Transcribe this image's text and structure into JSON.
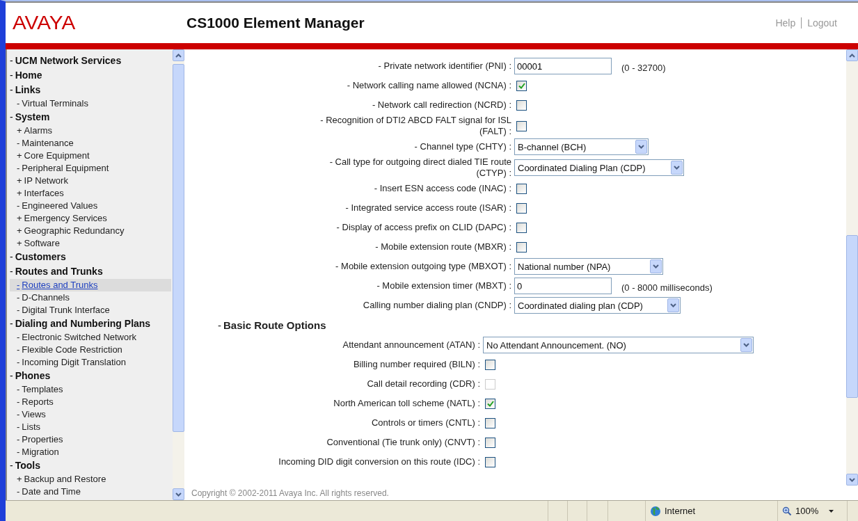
{
  "header": {
    "logo": "AVAYA",
    "title": "CS1000 Element Manager",
    "links": [
      "Help",
      "Logout"
    ]
  },
  "sidebar": {
    "items": [
      {
        "marker": "-",
        "label": "UCM Network Services",
        "selected": false
      },
      {
        "marker": "-",
        "label": "Home",
        "selected": false
      },
      {
        "marker": "-",
        "label": "Links",
        "selected": false,
        "children": [
          {
            "marker": "-",
            "label": "Virtual Terminals",
            "selected": false
          }
        ]
      },
      {
        "marker": "-",
        "label": "System",
        "selected": false,
        "children": [
          {
            "marker": "+",
            "label": "Alarms",
            "selected": false
          },
          {
            "marker": "-",
            "label": "Maintenance",
            "selected": false
          },
          {
            "marker": "+",
            "label": "Core Equipment",
            "selected": false
          },
          {
            "marker": "-",
            "label": "Peripheral Equipment",
            "selected": false
          },
          {
            "marker": "+",
            "label": "IP Network",
            "selected": false
          },
          {
            "marker": "+",
            "label": "Interfaces",
            "selected": false
          },
          {
            "marker": "-",
            "label": "Engineered Values",
            "selected": false
          },
          {
            "marker": "+",
            "label": "Emergency Services",
            "selected": false
          },
          {
            "marker": "+",
            "label": "Geographic Redundancy",
            "selected": false
          },
          {
            "marker": "+",
            "label": "Software",
            "selected": false
          }
        ]
      },
      {
        "marker": "-",
        "label": "Customers",
        "selected": false
      },
      {
        "marker": "-",
        "label": "Routes and Trunks",
        "selected": false,
        "children": [
          {
            "marker": "-",
            "label": "Routes and Trunks",
            "selected": true
          },
          {
            "marker": "-",
            "label": "D-Channels",
            "selected": false
          },
          {
            "marker": "-",
            "label": "Digital Trunk Interface",
            "selected": false
          }
        ]
      },
      {
        "marker": "-",
        "label": "Dialing and Numbering Plans",
        "selected": false,
        "children": [
          {
            "marker": "-",
            "label": "Electronic Switched Network",
            "selected": false
          },
          {
            "marker": "-",
            "label": "Flexible Code Restriction",
            "selected": false
          },
          {
            "marker": "-",
            "label": "Incoming Digit Translation",
            "selected": false
          }
        ]
      },
      {
        "marker": "-",
        "label": "Phones",
        "selected": false,
        "children": [
          {
            "marker": "-",
            "label": "Templates",
            "selected": false
          },
          {
            "marker": "-",
            "label": "Reports",
            "selected": false
          },
          {
            "marker": "-",
            "label": "Views",
            "selected": false
          },
          {
            "marker": "-",
            "label": "Lists",
            "selected": false
          },
          {
            "marker": "-",
            "label": "Properties",
            "selected": false
          },
          {
            "marker": "-",
            "label": "Migration",
            "selected": false
          }
        ]
      },
      {
        "marker": "-",
        "label": "Tools",
        "selected": false,
        "children": [
          {
            "marker": "+",
            "label": "Backup and Restore",
            "selected": false
          },
          {
            "marker": "-",
            "label": "Date and Time",
            "selected": false
          }
        ]
      }
    ]
  },
  "form": {
    "sections": [
      {
        "rows": [
          {
            "kind": "text",
            "label": "- Private network identifier (PNI) :",
            "value": "00001",
            "note": "(0 - 32700)"
          },
          {
            "kind": "checkbox",
            "label": "- Network calling name allowed (NCNA) :",
            "checked": true,
            "disabled": false
          },
          {
            "kind": "checkbox",
            "label": "- Network call redirection (NCRD) :",
            "checked": false,
            "disabled": false
          },
          {
            "kind": "checkbox",
            "label": "- Recognition of DTI2 ABCD FALT signal for ISL (FALT) :",
            "checked": false,
            "disabled": false
          },
          {
            "kind": "select",
            "label": "- Channel type  (CHTY) :",
            "value": "B-channel (BCH)"
          },
          {
            "kind": "select",
            "label": "- Call type for outgoing direct dialed TIE route (CTYP) :",
            "value": "Coordinated Dialing Plan (CDP)"
          },
          {
            "kind": "checkbox",
            "label": "- Insert ESN access code  (INAC) :",
            "checked": false,
            "disabled": false
          },
          {
            "kind": "checkbox",
            "label": "- Integrated service access route (ISAR) :",
            "checked": false,
            "disabled": false
          },
          {
            "kind": "checkbox",
            "label": "- Display of access prefix on CLID (DAPC) :",
            "checked": false,
            "disabled": false
          },
          {
            "kind": "checkbox",
            "label": "- Mobile extension route (MBXR) :",
            "checked": false,
            "disabled": false
          },
          {
            "kind": "select",
            "label": "- Mobile extension outgoing type (MBXOT) :",
            "value": "National number (NPA)"
          },
          {
            "kind": "text",
            "label": "- Mobile extension timer (MBXT) :",
            "value": "0",
            "note": "(0 - 8000 milliseconds)"
          },
          {
            "kind": "select",
            "label": "Calling number dialing plan (CNDP) :",
            "value": "Coordinated dialing plan (CDP)"
          }
        ]
      },
      {
        "marker": "-",
        "heading": "Basic Route Options",
        "rows": [
          {
            "kind": "select",
            "label": "Attendant announcement (ATAN) :",
            "value": "No Attendant Announcement. (NO)"
          },
          {
            "kind": "checkbox",
            "label": "Billing number required (BILN) :",
            "checked": false,
            "disabled": false
          },
          {
            "kind": "checkbox",
            "label": "Call detail recording (CDR) :",
            "checked": false,
            "disabled": true
          },
          {
            "kind": "checkbox",
            "label": "North American toll scheme (NATL) :",
            "checked": true,
            "disabled": false
          },
          {
            "kind": "checkbox",
            "label": "Controls or timers (CNTL) :",
            "checked": false,
            "disabled": false
          },
          {
            "kind": "checkbox",
            "label": "Conventional (Tie trunk only) (CNVT) :",
            "checked": false,
            "disabled": false
          },
          {
            "kind": "checkbox",
            "label": "Incoming DID digit conversion on this route (IDC) :",
            "checked": false,
            "disabled": false
          }
        ]
      }
    ]
  },
  "footer": {
    "copyright": "Copyright © 2002-2011 Avaya Inc. All rights reserved."
  },
  "status_bar": {
    "zone": "Internet",
    "zoom": "100%"
  }
}
